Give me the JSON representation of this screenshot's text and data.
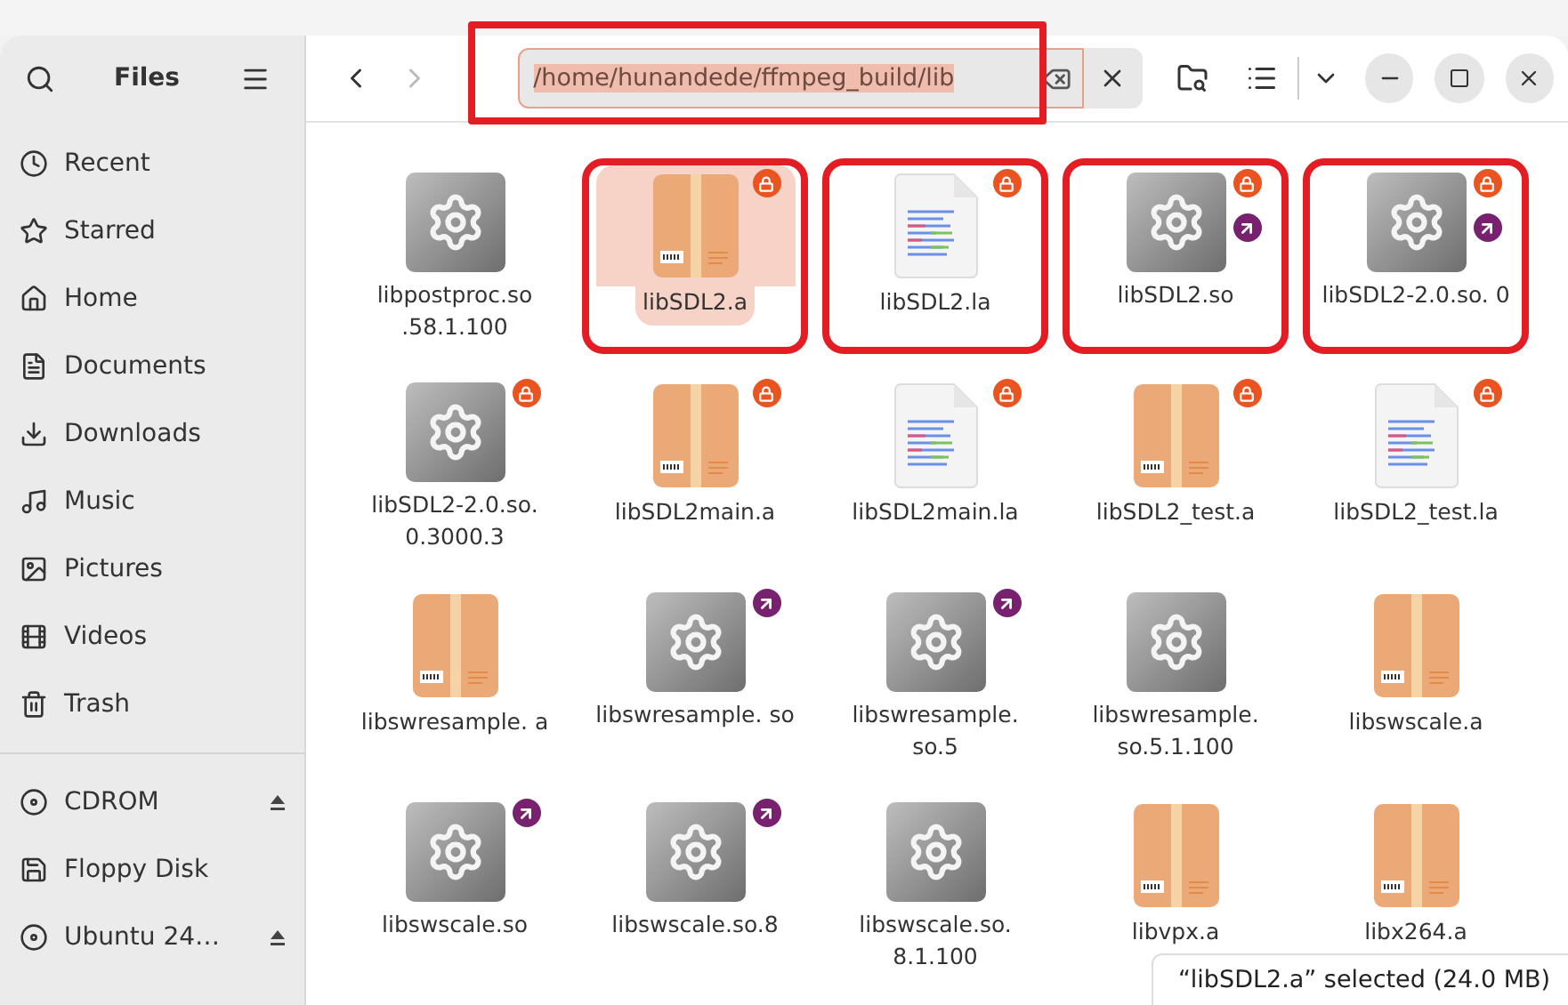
{
  "sidebar": {
    "title": "Files",
    "places": [
      {
        "kind": "recent",
        "label": "Recent"
      },
      {
        "kind": "starred",
        "label": "Starred"
      },
      {
        "kind": "home",
        "label": "Home"
      },
      {
        "kind": "documents",
        "label": "Documents"
      },
      {
        "kind": "downloads",
        "label": "Downloads"
      },
      {
        "kind": "music",
        "label": "Music"
      },
      {
        "kind": "pictures",
        "label": "Pictures"
      },
      {
        "kind": "videos",
        "label": "Videos"
      },
      {
        "kind": "trash",
        "label": "Trash"
      }
    ],
    "devices": [
      {
        "kind": "disc",
        "label": "CDROM",
        "ejectable": true
      },
      {
        "kind": "floppy",
        "label": "Floppy Disk",
        "ejectable": false
      },
      {
        "kind": "disc",
        "label": "Ubuntu 24…",
        "ejectable": true
      }
    ]
  },
  "location": {
    "path": "/home/hunandede/ffmpeg_build/lib",
    "text_selected": true,
    "annotated": true
  },
  "files": [
    {
      "kind": "library",
      "name": "libpostproc.so .58.1.100",
      "selected": false,
      "locked": false,
      "link": false,
      "annotated": false
    },
    {
      "kind": "archive",
      "name": "libSDL2.a",
      "selected": true,
      "locked": true,
      "link": false,
      "annotated": true
    },
    {
      "kind": "libtool",
      "name": "libSDL2.la",
      "selected": false,
      "locked": true,
      "link": false,
      "annotated": true
    },
    {
      "kind": "library",
      "name": "libSDL2.so",
      "selected": false,
      "locked": true,
      "link": true,
      "annotated": true
    },
    {
      "kind": "library",
      "name": "libSDL2-2.0.so. 0",
      "selected": false,
      "locked": true,
      "link": true,
      "annotated": true
    },
    {
      "kind": "library",
      "name": "libSDL2-2.0.so. 0.3000.3",
      "selected": false,
      "locked": true,
      "link": false,
      "annotated": false
    },
    {
      "kind": "archive",
      "name": "libSDL2main.a",
      "selected": false,
      "locked": true,
      "link": false,
      "annotated": false
    },
    {
      "kind": "libtool",
      "name": "libSDL2main.la",
      "selected": false,
      "locked": true,
      "link": false,
      "annotated": false
    },
    {
      "kind": "archive",
      "name": "libSDL2_test.a",
      "selected": false,
      "locked": true,
      "link": false,
      "annotated": false
    },
    {
      "kind": "libtool",
      "name": "libSDL2_test.la",
      "selected": false,
      "locked": true,
      "link": false,
      "annotated": false
    },
    {
      "kind": "archive",
      "name": "libswresample. a",
      "selected": false,
      "locked": false,
      "link": false,
      "annotated": false
    },
    {
      "kind": "library",
      "name": "libswresample. so",
      "selected": false,
      "locked": false,
      "link": true,
      "annotated": false
    },
    {
      "kind": "library",
      "name": "libswresample. so.5",
      "selected": false,
      "locked": false,
      "link": true,
      "annotated": false
    },
    {
      "kind": "library",
      "name": "libswresample. so.5.1.100",
      "selected": false,
      "locked": false,
      "link": false,
      "annotated": false
    },
    {
      "kind": "archive",
      "name": "libswscale.a",
      "selected": false,
      "locked": false,
      "link": false,
      "annotated": false
    },
    {
      "kind": "library",
      "name": "libswscale.so",
      "selected": false,
      "locked": false,
      "link": true,
      "annotated": false
    },
    {
      "kind": "library",
      "name": "libswscale.so.8",
      "selected": false,
      "locked": false,
      "link": true,
      "annotated": false
    },
    {
      "kind": "library",
      "name": "libswscale.so. 8.1.100",
      "selected": false,
      "locked": false,
      "link": false,
      "annotated": false
    },
    {
      "kind": "archive",
      "name": "libvpx.a",
      "selected": false,
      "locked": false,
      "link": false,
      "annotated": false
    },
    {
      "kind": "archive",
      "name": "libx264.a",
      "selected": false,
      "locked": false,
      "link": false,
      "annotated": false
    }
  ],
  "status_bar": "“libSDL2.a” selected (24.0 MB)"
}
